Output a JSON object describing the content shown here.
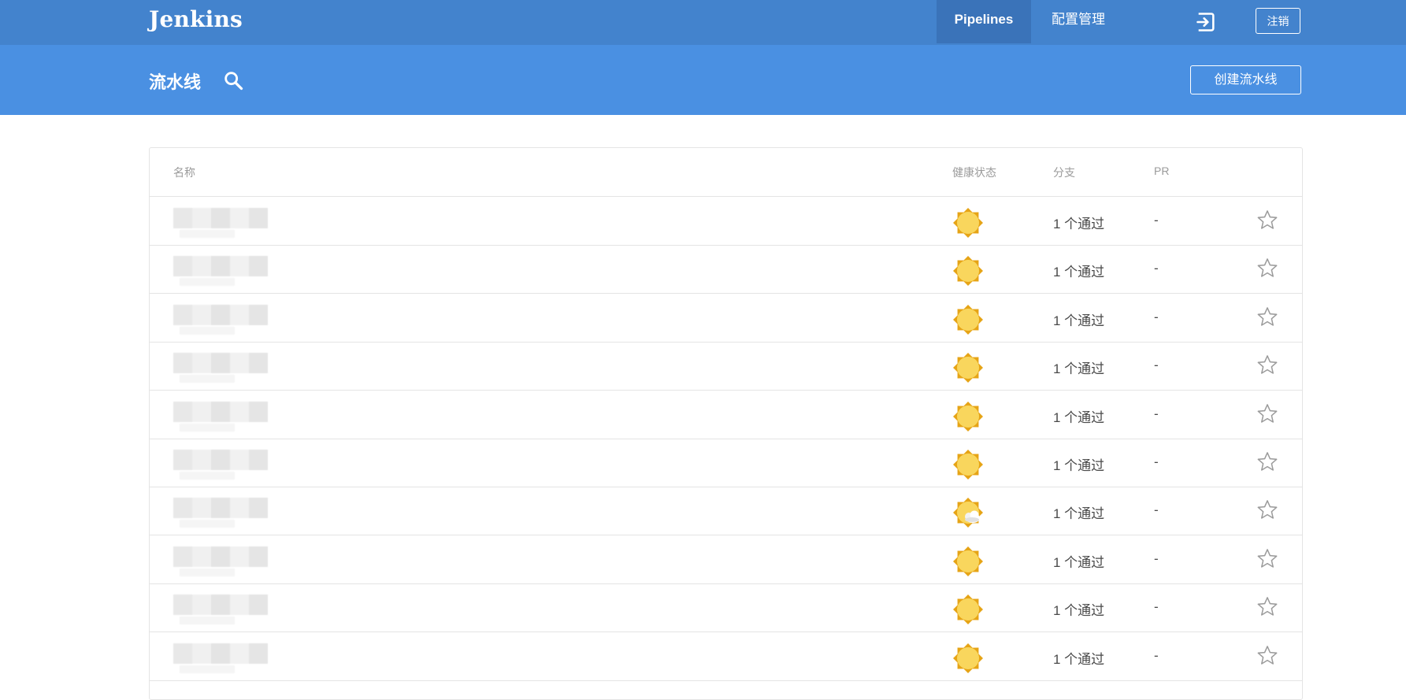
{
  "app": {
    "logo": "Jenkins"
  },
  "nav": {
    "tabs": [
      {
        "label": "Pipelines",
        "active": true
      },
      {
        "label": "配置管理",
        "active": false
      }
    ],
    "logout_label": "注销",
    "exit_icon": "exit-icon"
  },
  "header": {
    "title": "流水线",
    "search_icon": "search-icon",
    "create_label": "创建流水线"
  },
  "table": {
    "columns": {
      "name": "名称",
      "health": "健康状态",
      "branch": "分支",
      "pr": "PR"
    },
    "rows": [
      {
        "name": "",
        "health": "sunny",
        "branch": "1 个通过",
        "pr": "-",
        "favorite": false
      },
      {
        "name": "",
        "health": "sunny",
        "branch": "1 个通过",
        "pr": "-",
        "favorite": false
      },
      {
        "name": "",
        "health": "sunny",
        "branch": "1 个通过",
        "pr": "-",
        "favorite": false
      },
      {
        "name": "",
        "health": "sunny",
        "branch": "1 个通过",
        "pr": "-",
        "favorite": false
      },
      {
        "name": "",
        "health": "sunny",
        "branch": "1 个通过",
        "pr": "-",
        "favorite": false
      },
      {
        "name": "",
        "health": "sunny",
        "branch": "1 个通过",
        "pr": "-",
        "favorite": false
      },
      {
        "name": "",
        "health": "partly-cloudy",
        "branch": "1 个通过",
        "pr": "-",
        "favorite": false
      },
      {
        "name": "",
        "health": "sunny",
        "branch": "1 个通过",
        "pr": "-",
        "favorite": false
      },
      {
        "name": "",
        "health": "sunny",
        "branch": "1 个通过",
        "pr": "-",
        "favorite": false
      },
      {
        "name": "",
        "health": "sunny",
        "branch": "1 个通过",
        "pr": "-",
        "favorite": false
      }
    ]
  },
  "colors": {
    "topbar": "#4383cd",
    "topbar_active_tab": "#3a73b9",
    "subheader": "#4a90e2",
    "sun": "#f9d65d",
    "sun_border": "#e6a416",
    "star": "#9b9b9b"
  }
}
